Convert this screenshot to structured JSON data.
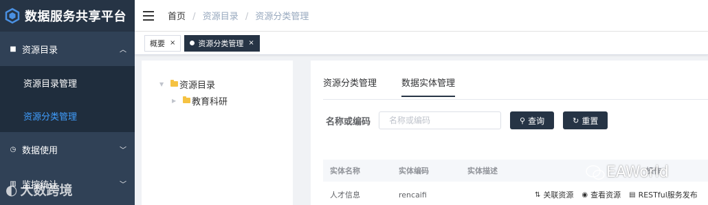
{
  "app": {
    "title": "数据服务共享平台"
  },
  "sidebar": {
    "items": [
      {
        "label": "资源目录",
        "expanded": true,
        "children": [
          {
            "label": "资源目录管理",
            "active": false
          },
          {
            "label": "资源分类管理",
            "active": true
          }
        ]
      },
      {
        "label": "数据使用"
      },
      {
        "label": "监控统计"
      }
    ]
  },
  "breadcrumb": [
    "首页",
    "资源目录",
    "资源分类管理"
  ],
  "tags": [
    {
      "label": "概要",
      "active": false
    },
    {
      "label": "资源分类管理",
      "active": true
    }
  ],
  "tree": {
    "root": "资源目录",
    "children": [
      "教育科研"
    ]
  },
  "main": {
    "tabs": [
      {
        "label": "资源分类管理",
        "active": false
      },
      {
        "label": "数据实体管理",
        "active": true
      }
    ],
    "search": {
      "label": "名称或编码",
      "placeholder": "名称或编码",
      "value": "",
      "query_label": "查询",
      "reset_label": "重置"
    },
    "table": {
      "headers": [
        "实体名称",
        "实体编码",
        "实体描述",
        "操作"
      ],
      "rows": [
        {
          "name": "人才信息",
          "code": "rencaifi",
          "desc": ""
        }
      ],
      "actions": [
        "关联资源",
        "查看资源",
        "RESTful服务发布"
      ]
    }
  },
  "watermark": {
    "right": "EAWorld",
    "left": "大数跨境"
  },
  "colors": {
    "sidebar_bg": "#304156",
    "logo_bg": "#263445",
    "submenu_bg": "#1f2d3d",
    "accent": "#409eff",
    "button_bg": "#263445"
  }
}
